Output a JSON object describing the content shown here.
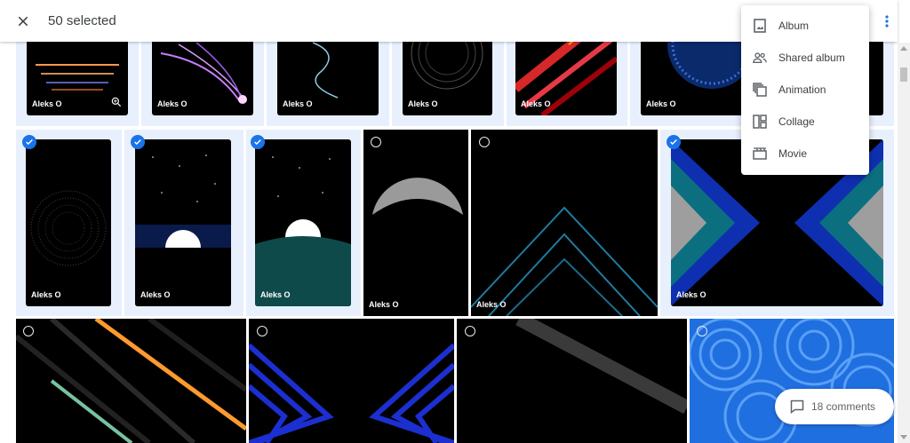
{
  "header": {
    "selected_count_label": "50 selected"
  },
  "menu": {
    "items": [
      {
        "label": "Album",
        "icon": "album-icon"
      },
      {
        "label": "Shared album",
        "icon": "shared-album-icon"
      },
      {
        "label": "Animation",
        "icon": "animation-icon"
      },
      {
        "label": "Collage",
        "icon": "collage-icon"
      },
      {
        "label": "Movie",
        "icon": "movie-icon"
      }
    ]
  },
  "photos": {
    "row1": [
      "Aleks O",
      "Aleks O",
      "Aleks O",
      "Aleks O",
      "Aleks O",
      "Aleks O"
    ],
    "row2": [
      "Aleks O",
      "Aleks O",
      "Aleks O",
      "Aleks O",
      "Aleks O",
      "Aleks O"
    ]
  },
  "comments": {
    "label": "18 comments"
  },
  "colors": {
    "accent": "#1a73e8",
    "selected_bg": "#e8f0fe",
    "text": "#3c4043"
  }
}
